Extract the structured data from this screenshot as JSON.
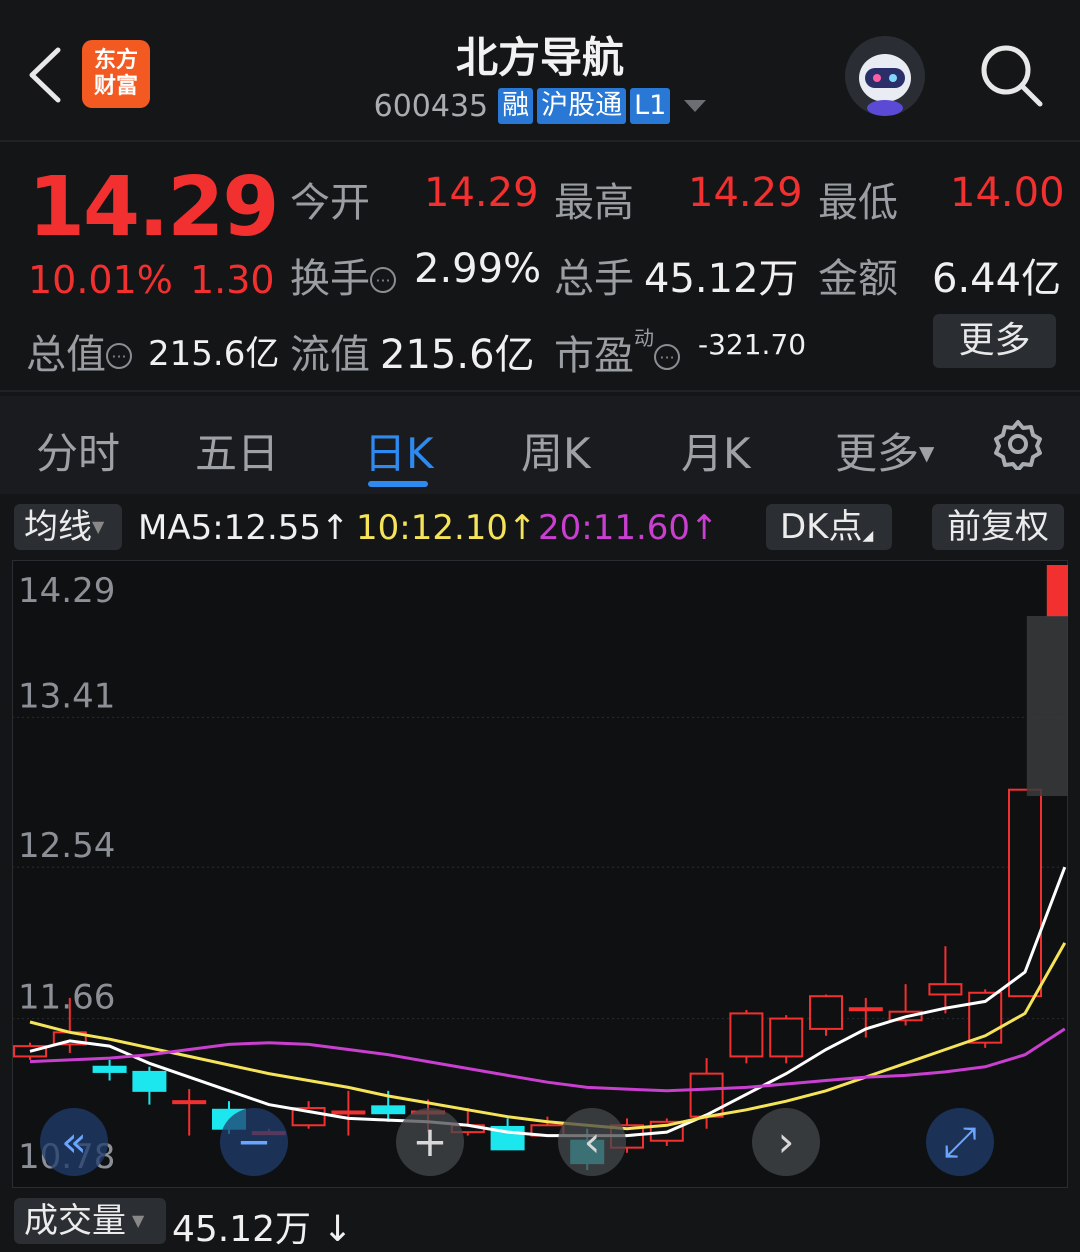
{
  "header": {
    "back_icon": "chevron-left-icon",
    "logo_line1": "东方",
    "logo_line2": "财富",
    "title": "北方导航",
    "code": "600435",
    "tags": [
      "融",
      "沪股通",
      "L1"
    ],
    "search_icon": "search-icon",
    "avatar_icon": "robot-avatar-icon"
  },
  "quote": {
    "price": "14.29",
    "change_pct": "10.01%",
    "change_amt": "1.30",
    "open_label": "今开",
    "open": "14.29",
    "high_label": "最高",
    "high": "14.29",
    "low_label": "最低",
    "low": "14.00",
    "turnover_label": "换手",
    "turnover": "2.99%",
    "volume_label": "总手",
    "volume": "45.12万",
    "amount_label": "金额",
    "amount": "6.44亿",
    "mktcap_label": "总值",
    "mktcap": "215.6亿",
    "float_label": "流值",
    "float_cap": "215.6亿",
    "pe_label": "市盈",
    "pe_sup": "动",
    "pe": "-321.70",
    "more_label": "更多"
  },
  "tabs": [
    "分时",
    "五日",
    "日K",
    "周K",
    "月K",
    "更多"
  ],
  "active_tab": "日K",
  "settings_icon": "gear-icon",
  "ma_row": {
    "selector": "均线",
    "ma5": "MA5:12.55↑",
    "ma10": "10:12.10↑",
    "ma20": "20:11.60↑",
    "dk": "DK点",
    "adjust": "前复权"
  },
  "colors": {
    "up": "#f2302f",
    "down": "#1de7ee",
    "ma5": "#ffffff",
    "ma10": "#f5e35a",
    "ma20": "#c93fd0",
    "accent": "#2f8af0"
  },
  "chart_data": {
    "type": "candlestick",
    "y_ticks": [
      "14.29",
      "13.41",
      "12.54",
      "11.66",
      "10.78"
    ],
    "ylim": [
      10.78,
      14.29
    ],
    "candles": [
      {
        "o": 11.44,
        "c": 11.5,
        "h": 11.52,
        "l": 11.42
      },
      {
        "o": 11.51,
        "c": 11.58,
        "h": 11.78,
        "l": 11.46
      },
      {
        "o": 11.38,
        "c": 11.35,
        "h": 11.42,
        "l": 11.3
      },
      {
        "o": 11.35,
        "c": 11.24,
        "h": 11.38,
        "l": 11.16
      },
      {
        "o": 11.18,
        "c": 11.18,
        "h": 11.25,
        "l": 10.98
      },
      {
        "o": 11.13,
        "c": 11.02,
        "h": 11.18,
        "l": 10.99
      },
      {
        "o": 11.0,
        "c": 11.0,
        "h": 11.02,
        "l": 11.0
      },
      {
        "o": 11.04,
        "c": 11.14,
        "h": 11.18,
        "l": 11.02
      },
      {
        "o": 11.12,
        "c": 11.12,
        "h": 11.24,
        "l": 10.98
      },
      {
        "o": 11.15,
        "c": 11.11,
        "h": 11.24,
        "l": 11.06
      },
      {
        "o": 11.12,
        "c": 11.12,
        "h": 11.19,
        "l": 11.0
      },
      {
        "o": 11.0,
        "c": 11.04,
        "h": 11.14,
        "l": 10.98
      },
      {
        "o": 11.03,
        "c": 10.9,
        "h": 11.08,
        "l": 10.9
      },
      {
        "o": 10.98,
        "c": 11.04,
        "h": 11.09,
        "l": 10.98
      },
      {
        "o": 10.95,
        "c": 10.82,
        "h": 11.02,
        "l": 10.78
      },
      {
        "o": 10.91,
        "c": 11.04,
        "h": 11.08,
        "l": 10.88
      },
      {
        "o": 10.95,
        "c": 11.06,
        "h": 11.08,
        "l": 10.92
      },
      {
        "o": 11.09,
        "c": 11.34,
        "h": 11.43,
        "l": 11.02
      },
      {
        "o": 11.44,
        "c": 11.69,
        "h": 11.71,
        "l": 11.4
      },
      {
        "o": 11.44,
        "c": 11.66,
        "h": 11.68,
        "l": 11.4
      },
      {
        "o": 11.6,
        "c": 11.79,
        "h": 11.8,
        "l": 11.56
      },
      {
        "o": 11.72,
        "c": 11.72,
        "h": 11.78,
        "l": 11.55
      },
      {
        "o": 11.65,
        "c": 11.7,
        "h": 11.86,
        "l": 11.62
      },
      {
        "o": 11.8,
        "c": 11.86,
        "h": 12.08,
        "l": 11.69
      },
      {
        "o": 11.52,
        "c": 11.81,
        "h": 11.83,
        "l": 11.49
      },
      {
        "o": 11.79,
        "c": 12.99,
        "h": 12.99,
        "l": 11.79
      },
      {
        "o": 14.0,
        "c": 14.29,
        "h": 14.29,
        "l": 14.0
      }
    ],
    "ma5": [
      11.47,
      11.53,
      11.5,
      11.4,
      11.32,
      11.24,
      11.16,
      11.12,
      11.08,
      11.07,
      11.06,
      11.04,
      11.0,
      10.98,
      10.98,
      10.98,
      11.0,
      11.1,
      11.22,
      11.34,
      11.48,
      11.6,
      11.67,
      11.72,
      11.76,
      11.93,
      12.54
    ],
    "ma10": [
      11.64,
      11.58,
      11.54,
      11.49,
      11.44,
      11.39,
      11.34,
      11.3,
      11.26,
      11.21,
      11.17,
      11.13,
      11.09,
      11.06,
      11.04,
      11.02,
      11.04,
      11.09,
      11.13,
      11.18,
      11.24,
      11.32,
      11.4,
      11.48,
      11.56,
      11.69,
      12.1
    ],
    "ma20": [
      11.41,
      11.42,
      11.43,
      11.45,
      11.48,
      11.51,
      11.52,
      11.51,
      11.48,
      11.45,
      11.41,
      11.37,
      11.33,
      11.29,
      11.26,
      11.25,
      11.24,
      11.25,
      11.26,
      11.28,
      11.3,
      11.32,
      11.33,
      11.35,
      11.38,
      11.45,
      11.6
    ],
    "nav_buttons": [
      "double-left-icon",
      "minus-icon",
      "plus-icon",
      "left-icon",
      "right-icon",
      "expand-icon"
    ]
  },
  "volume_row": {
    "selector": "成交量",
    "value": "45.12万 ↓"
  }
}
